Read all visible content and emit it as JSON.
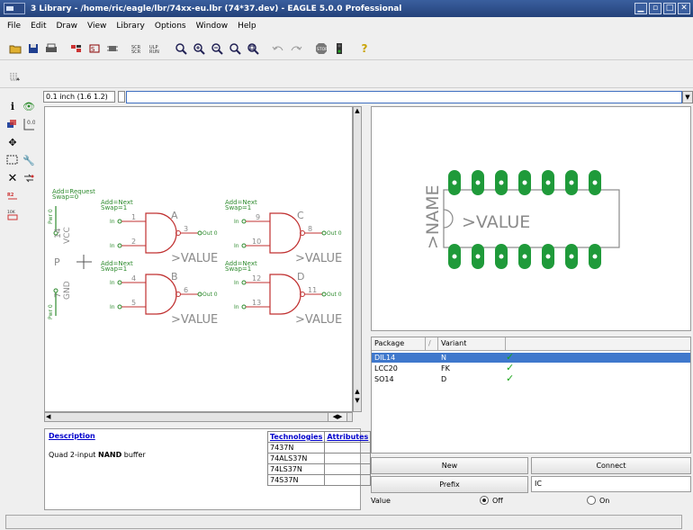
{
  "window": {
    "title": "3 Library - /home/ric/eagle/lbr/74xx-eu.lbr (74*37.dev) - EAGLE 5.0.0 Professional"
  },
  "menu": {
    "items": [
      "File",
      "Edit",
      "Draw",
      "View",
      "Library",
      "Options",
      "Window",
      "Help"
    ]
  },
  "toolbar": {
    "icons": [
      "open-icon",
      "save-icon",
      "print-icon",
      "layer-icon",
      "symbol-icon",
      "package-icon",
      "script-icon",
      "run-icon",
      "zoom-fit-icon",
      "zoom-in-icon",
      "zoom-out-icon",
      "zoom-redraw-icon",
      "zoom-area-icon",
      "undo-icon",
      "redo-icon",
      "stop-icon",
      "go-icon",
      "help-icon"
    ]
  },
  "command": {
    "grid_text": "0.1 inch (1.6 1.2)",
    "value": ""
  },
  "schematic": {
    "gates": [
      {
        "name": "A",
        "pins_in": [
          "1",
          "2"
        ],
        "pin_out": "3"
      },
      {
        "name": "B",
        "pins_in": [
          "4",
          "5"
        ],
        "pin_out": "6"
      },
      {
        "name": "C",
        "pins_in": [
          "9",
          "10"
        ],
        "pin_out": "8"
      },
      {
        "name": "D",
        "pins_in": [
          "12",
          "13"
        ],
        "pin_out": "11"
      }
    ],
    "value_label": ">VALUE",
    "addlevel_request": "Add=Request",
    "swap0": "Swap=0",
    "addlevel_next": "Add=Next",
    "swap1": "Swap=1",
    "pin_in_label": "In",
    "pin_out_label": "Out 0",
    "power_gate": "P",
    "vcc_label": "VCC",
    "gnd_label": "GND",
    "pwr_pin_vcc": "14",
    "pwr_pin_gnd": "7",
    "pwr_label": "Pwr 0"
  },
  "package": {
    "name_label": ">NAME",
    "value_label": ">VALUE"
  },
  "description": {
    "heading": "Description",
    "text_plain": "Quad 2-input ",
    "text_bold": "NAND",
    "text_rest": " buffer"
  },
  "technologies": {
    "col_tech": "Technologies",
    "col_attr": "Attributes",
    "rows": [
      "7437N",
      "74ALS37N",
      "74LS37N",
      "74S37N"
    ]
  },
  "variants": {
    "col_package": "Package",
    "col_sort": "/",
    "col_variant": "Variant",
    "rows": [
      {
        "package": "DIL14",
        "variant": "N",
        "check": "✓"
      },
      {
        "package": "LCC20",
        "variant": "FK",
        "check": "✓"
      },
      {
        "package": "SO14",
        "variant": "D",
        "check": "✓"
      }
    ]
  },
  "buttons": {
    "new": "New",
    "connect": "Connect",
    "prefix": "Prefix",
    "prefix_value": "IC"
  },
  "value_option": {
    "label": "Value",
    "off": "Off",
    "on": "On",
    "selected": "Off"
  },
  "colors": {
    "schematic_red": "#c03030",
    "schematic_green": "#2e8b2e",
    "schematic_gray": "#8a8a8a",
    "pad_green": "#1f9a3a",
    "selection_blue": "#3f78cc"
  }
}
